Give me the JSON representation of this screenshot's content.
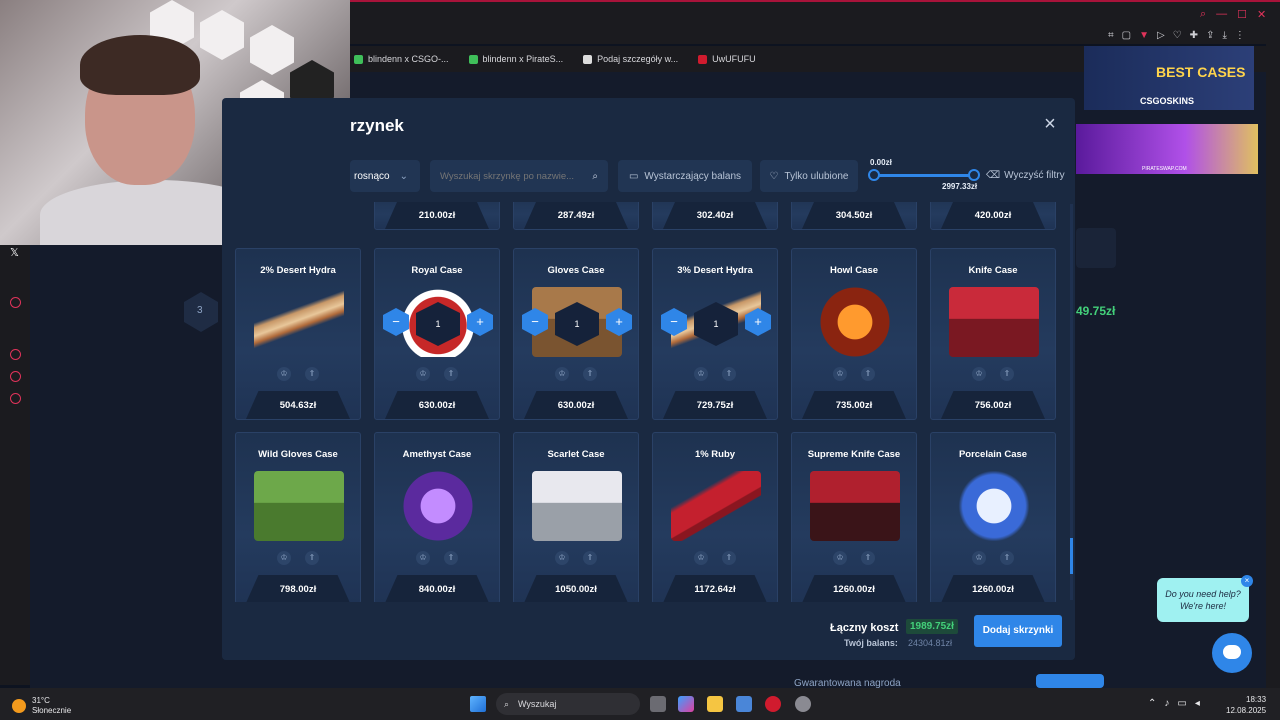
{
  "bookmarks": [
    {
      "label": "blindenn x CSGO-...",
      "color": "#3fbf5a"
    },
    {
      "label": "blindenn x PirateS...",
      "color": "#3fbf5a"
    },
    {
      "label": "Podaj szczegóły w...",
      "color": "#dcdcdc"
    },
    {
      "label": "UwUFUFU",
      "color": "#d01b2e"
    }
  ],
  "ad": {
    "best_cases": "BEST CASES",
    "brand": "CSGOSKINS",
    "site": "PIRATESWAP.COM"
  },
  "modal": {
    "title": "rzynek",
    "close_icon": "×",
    "sort_label": "rosnąco",
    "search_placeholder": "Wyszukaj skrzynkę po nazwie...",
    "balance_filter": "Wystarczający balans",
    "favorites_filter": "Tylko ulubione",
    "range_min": "0.00zł",
    "range_max": "2997.33zł",
    "clear_filters": "Wyczyść filtry"
  },
  "top_row_prices": [
    "210.00zł",
    "287.49zł",
    "302.40zł",
    "304.50zł",
    "420.00zł"
  ],
  "cards": [
    {
      "name": "2% Desert Hydra",
      "price": "504.63zł",
      "art": "rifle",
      "qty": null
    },
    {
      "name": "Royal Case",
      "price": "630.00zł",
      "art": "royal",
      "qty": "1"
    },
    {
      "name": "Gloves Case",
      "price": "630.00zł",
      "art": "crate",
      "qty": "1"
    },
    {
      "name": "3% Desert Hydra",
      "price": "729.75zł",
      "art": "rifle",
      "qty": "1"
    },
    {
      "name": "Howl Case",
      "price": "735.00zł",
      "art": "fire",
      "qty": null
    },
    {
      "name": "Knife Case",
      "price": "756.00zł",
      "art": "red",
      "qty": null
    },
    {
      "name": "Wild Gloves Case",
      "price": "798.00zł",
      "art": "green",
      "qty": null
    },
    {
      "name": "Amethyst Case",
      "price": "840.00zł",
      "art": "purple",
      "qty": null
    },
    {
      "name": "Scarlet Case",
      "price": "1050.00zł",
      "art": "silver",
      "qty": null
    },
    {
      "name": "1% Ruby",
      "price": "1172.64zł",
      "art": "knife",
      "qty": null
    },
    {
      "name": "Supreme Knife Case",
      "price": "1260.00zł",
      "art": "darkred",
      "qty": null
    },
    {
      "name": "Porcelain Case",
      "price": "1260.00zł",
      "art": "porcelain",
      "qty": null
    }
  ],
  "footer": {
    "total_label": "Łączny koszt",
    "total_value": "1989.75zł",
    "balance_label": "Twój balans:",
    "balance_value": "24304.81zł",
    "add_button": "Dodaj skrzynki"
  },
  "behind": {
    "round_number": "3",
    "price_hint": "49.75zł",
    "guarantee": "Gwarantowana nagroda"
  },
  "help": {
    "bubble": "Do you need help? We're here!"
  },
  "taskbar": {
    "temp": "31°C",
    "weather": "Słonecznie",
    "search": "Wyszukaj",
    "time": "18:33",
    "date": "12.08.2025"
  },
  "colors": {
    "accent": "#2f86e8",
    "success": "#43d07a",
    "modal_bg": "#1a2941"
  }
}
